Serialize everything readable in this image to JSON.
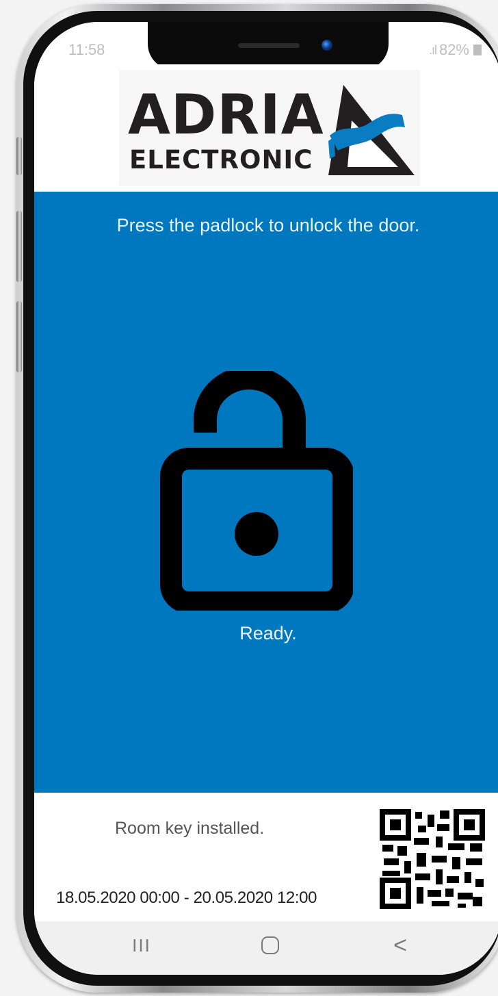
{
  "status_bar": {
    "time": "11:58",
    "battery": "82%",
    "icons": [
      "signal-icon",
      "battery-icon"
    ]
  },
  "brand": {
    "name_main": "ADRIA",
    "name_sub": "ELECTRONIC",
    "logo_icon": "adria-triangle-logo",
    "colors": {
      "dark": "#231f20",
      "wave": "#0a7cc2"
    }
  },
  "unlock": {
    "instruction": "Press the padlock to unlock the door.",
    "padlock_icon": "padlock-open-icon",
    "status": "Ready.",
    "background": "#0078c0"
  },
  "key": {
    "status": "Room key installed.",
    "validity": "18.05.2020 00:00 - 20.05.2020 12:00",
    "qr_icon": "qr-code-icon"
  },
  "nav": {
    "recent": "III",
    "back": "<",
    "icons": [
      "recent-apps-icon",
      "home-icon",
      "back-icon"
    ]
  }
}
